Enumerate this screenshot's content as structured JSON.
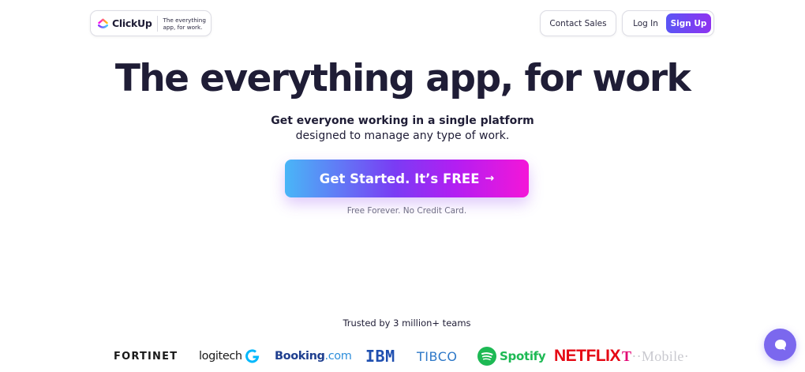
{
  "header": {
    "brand_name": "ClickUp",
    "brand_tagline": "The everything app, for work.",
    "contact_label": "Contact Sales",
    "login_label": "Log In",
    "signup_label": "Sign Up",
    "accent_gradient": [
      "#5a55f5",
      "#8e33f0"
    ]
  },
  "hero": {
    "title": "The everything app, for work",
    "subtitle_line1": "Get everyone working in a single platform",
    "subtitle_line2": "designed to manage any type of work.",
    "cta_label": "Get Started. It’s FREE",
    "cta_arrow": "→",
    "cta_note": "Free Forever. No Credit Card.",
    "cta_gradient": [
      "#49b6f7",
      "#7a3cf4",
      "#b31ef2",
      "#f416d8"
    ]
  },
  "trusted": {
    "heading": "Trusted by 3 million+ teams",
    "logos": {
      "fortinet": "FORTINET",
      "logitech": "logitech",
      "booking_main": "Booking",
      "booking_suffix": ".com",
      "ibm": "IBM",
      "tibco": "TIBCO",
      "spotify": "Spotify",
      "netflix": "NETFLIX",
      "tmobile_t": "T",
      "tmobile_rest": "··Mobile·"
    }
  },
  "chat": {
    "icon": "chat-bubble-icon",
    "color": "#7b68ee"
  }
}
